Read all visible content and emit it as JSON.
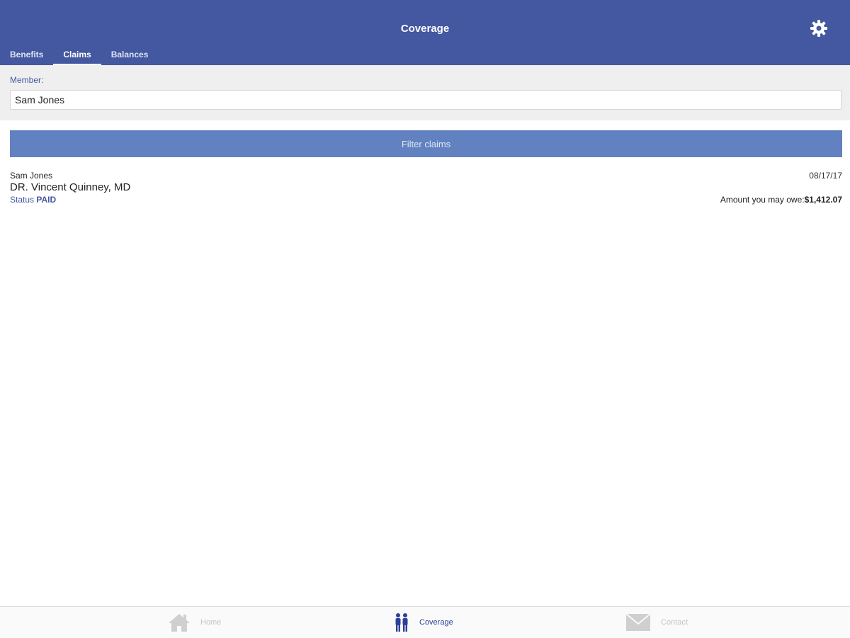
{
  "header": {
    "title": "Coverage",
    "settings_icon": "gear-icon",
    "color": "#4358a0"
  },
  "tabs": [
    {
      "label": "Benefits",
      "active": false
    },
    {
      "label": "Claims",
      "active": true
    },
    {
      "label": "Balances",
      "active": false
    }
  ],
  "member": {
    "label": "Member:",
    "value": "Sam Jones"
  },
  "filter_button": {
    "label": "Filter claims",
    "color": "#6281c0"
  },
  "claims": [
    {
      "member": "Sam Jones",
      "provider": "DR. Vincent Quinney, MD",
      "date": "08/17/17",
      "status_label": "Status",
      "status_value": "PAID",
      "owe_label": "Amount you may owe:",
      "owe_amount": "$1,412.07"
    }
  ],
  "bottom_nav": [
    {
      "label": "Home",
      "icon": "home-icon",
      "active": false
    },
    {
      "label": "Coverage",
      "icon": "people-icon",
      "active": true
    },
    {
      "label": "Contact",
      "icon": "envelope-icon",
      "active": false
    }
  ]
}
